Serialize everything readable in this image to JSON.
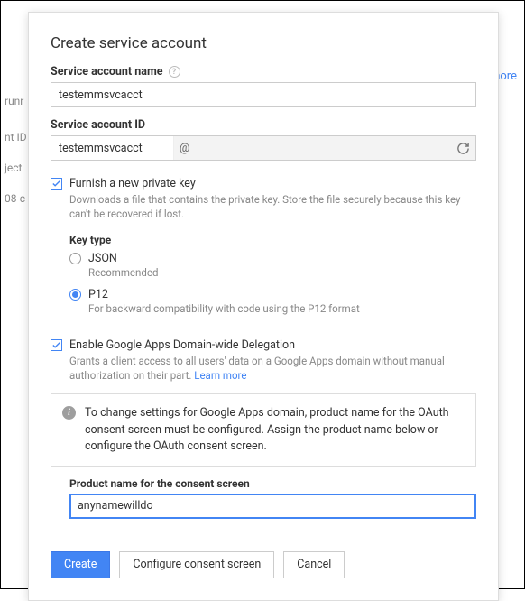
{
  "background": {
    "right_link": "nore",
    "left_1": "nt ID",
    "left_2": "ject",
    "left_3": "08-c",
    "left_4": "runr"
  },
  "dialog": {
    "title": "Create service account",
    "name_field": {
      "label": "Service account name",
      "value": "testemmsvcacct"
    },
    "id_field": {
      "label": "Service account ID",
      "value": "testemmsvcacct",
      "at": "@"
    },
    "furnish": {
      "label": "Furnish a new private key",
      "helper": "Downloads a file that contains the private key. Store the file securely because this key can't be recovered if lost."
    },
    "keytype": {
      "title": "Key type",
      "json": {
        "label": "JSON",
        "helper": "Recommended"
      },
      "p12": {
        "label": "P12",
        "helper": "For backward compatibility with code using the P12 format"
      }
    },
    "delegation": {
      "label": "Enable Google Apps Domain-wide Delegation",
      "helper": "Grants a client access to all users' data on a Google Apps domain without manual authorization on their part. ",
      "learn_more": "Learn more"
    },
    "notice": "To change settings for Google Apps domain, product name for the OAuth consent screen must be configured. Assign the product name below or configure the OAuth consent screen.",
    "consent": {
      "label": "Product name for the consent screen",
      "value": "anynamewilldo"
    },
    "buttons": {
      "create": "Create",
      "configure": "Configure consent screen",
      "cancel": "Cancel"
    }
  }
}
